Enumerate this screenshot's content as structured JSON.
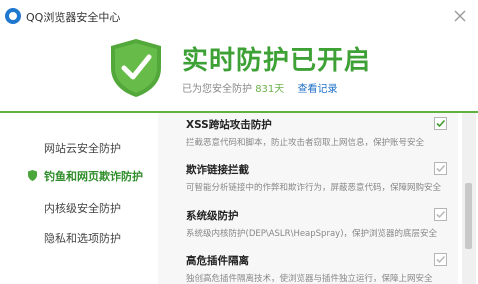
{
  "app": {
    "title": "QQ浏览器安全中心"
  },
  "header": {
    "headline": "实时防护已开启",
    "sub_prefix": "已为您安全防护",
    "days": "831天",
    "record_link": "查看记录"
  },
  "sidebar": {
    "items": [
      {
        "label": "网站云安全防护",
        "active": false
      },
      {
        "label": "钓鱼和网页欺诈防护",
        "active": true
      },
      {
        "label": "内核级安全防护",
        "active": false
      },
      {
        "label": "隐私和选项防护",
        "active": false
      }
    ]
  },
  "features": [
    {
      "title": "XSS跨站攻击防护",
      "desc": "拦截恶意代码和脚本，防止攻击者窃取上网信息，保护账号安全",
      "checked": true
    },
    {
      "title": "欺诈链接拦截",
      "desc": "可智能分析链接中的作弊和欺诈行为，屏蔽恶意代码，保障网购安全",
      "checked": true
    },
    {
      "title": "系统级防护",
      "desc": "系统级内核防护(DEP\\ASLR\\HeapSpray)，保护浏览器的底层安全",
      "checked": true
    },
    {
      "title": "高危插件隔离",
      "desc": "独创高危插件隔离技术，使浏览器与插件独立运行，保障上网安全",
      "checked": true
    }
  ],
  "colors": {
    "accent": "#3ea136",
    "link": "#1e6fc7",
    "divider": "#5fb240"
  }
}
